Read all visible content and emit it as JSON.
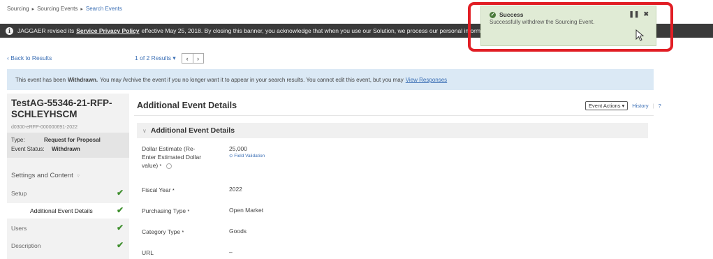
{
  "breadcrumb": {
    "items": [
      {
        "label": "Sourcing"
      },
      {
        "label": "Sourcing Events"
      },
      {
        "label": "Search Events"
      }
    ],
    "separator": "▸"
  },
  "banner": {
    "prefix": "JAGGAER revised its",
    "link": "Service Privacy Policy",
    "text": "effective May 25, 2018. By closing this banner, you acknowledge that when you use our Solution, we process our personal information as described in our Service Privacy Policy."
  },
  "toast": {
    "title": "Success",
    "message": "Successfully withdrew the Sourcing Event."
  },
  "nav": {
    "back": "‹ Back to Results",
    "results": "1 of 2 Results ▾",
    "prev": "‹",
    "next": "›"
  },
  "alert": {
    "prefix": "This event has been",
    "status": "Withdrawn.",
    "text": "You may Archive the event if you no longer want it to appear in your search results. You cannot edit this event, but you may",
    "link": "View Responses"
  },
  "sidebar": {
    "title_line1": "TestAG-55346-21-RFP-",
    "title_line2": "SCHLEYHSCM",
    "event_id": "d0300-eRFP-000000691-2022",
    "type_label": "Type:",
    "type_value": "Request for Proposal",
    "status_label": "Event Status:",
    "status_value": "Withdrawn",
    "settings_heading": "Settings and Content",
    "items": [
      {
        "label": "Setup"
      },
      {
        "label": "Additional Event Details"
      },
      {
        "label": "Users"
      },
      {
        "label": "Description"
      }
    ]
  },
  "panel": {
    "title": "Additional Event Details",
    "event_actions": "Event Actions ▾",
    "history": "History",
    "help": "?",
    "section_title": "Additional Event Details",
    "fields": [
      {
        "label_lines": [
          "Dollar Estimate (Re-",
          "Enter Estimated Dollar",
          "value)"
        ],
        "value": "25,000",
        "sub": "⊙ Field Validation"
      },
      {
        "label": "Fiscal Year",
        "value": "2022"
      },
      {
        "label": "Purchasing Type",
        "value": "Open Market"
      },
      {
        "label": "Category Type",
        "value": "Goods"
      },
      {
        "label": "URL",
        "value": "–"
      }
    ]
  },
  "colors": {
    "link": "#3b6fb5",
    "banner_bg": "#3a3a3a",
    "toast_bg": "#e0ebd5",
    "alert_bg": "#dbe9f5",
    "highlight": "#e11d24",
    "check": "#3f8f2e"
  }
}
